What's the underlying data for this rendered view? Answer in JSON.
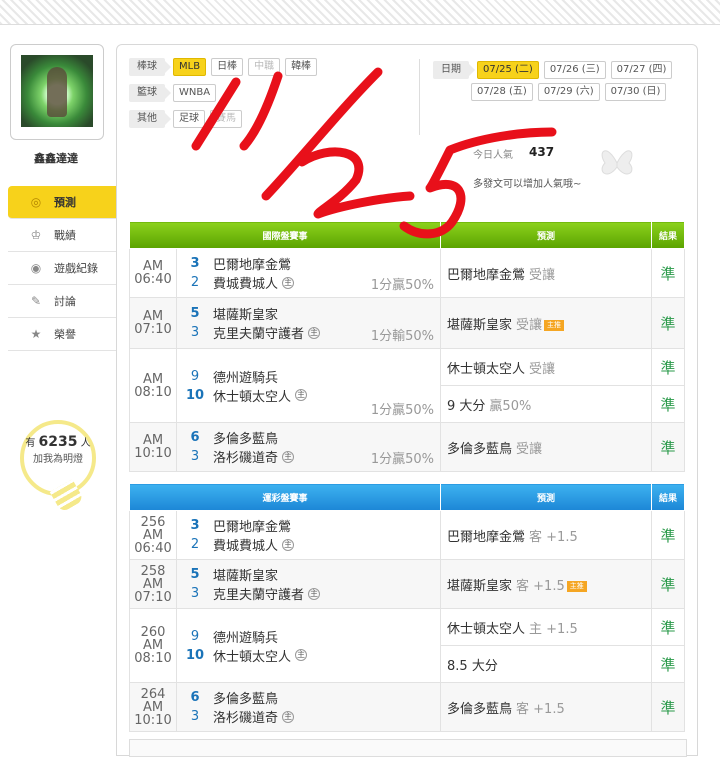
{
  "user": {
    "name": "鑫鑫達達"
  },
  "nav": [
    {
      "label": "預測",
      "icon": "target-icon",
      "active": true
    },
    {
      "label": "戰績",
      "icon": "trophy-icon",
      "active": false
    },
    {
      "label": "遊戲紀錄",
      "icon": "record-icon",
      "active": false
    },
    {
      "label": "討論",
      "icon": "discussion-icon",
      "active": false
    },
    {
      "label": "榮譽",
      "icon": "medal-icon",
      "active": false
    }
  ],
  "bulb": {
    "prefix": "有",
    "count": "6235",
    "unit": "人",
    "caption": "加我為明燈"
  },
  "filters": {
    "baseball_label": "棒球",
    "baseball": [
      "MLB",
      "日棒",
      "中職",
      "韓棒"
    ],
    "basketball_label": "籃球",
    "basketball": [
      "WNBA"
    ],
    "other_label": "其他",
    "other": [
      "足球",
      "賽馬"
    ]
  },
  "dates": {
    "label": "日期",
    "row1": [
      "07/25 (二)",
      "07/26 (三)",
      "07/27 (四)"
    ],
    "row2": [
      "07/28 (五)",
      "07/29 (六)",
      "07/30 (日)"
    ]
  },
  "popularity": {
    "label": "今日人氣",
    "value": "437",
    "tip": "多發文可以增加人氣哦~"
  },
  "intl": {
    "headers": [
      "國際盤賽事",
      "預測",
      "結果"
    ],
    "games": [
      {
        "time": "AM 06:40",
        "s1": "3",
        "t1": "巴爾地摩金鶯",
        "s2": "2",
        "t2": "費城費城人",
        "host": "主",
        "odds": "1分贏50%",
        "picks": [
          {
            "team": "巴爾地摩金鶯",
            "sub": "受讓",
            "badge": "",
            "result": "準"
          }
        ]
      },
      {
        "time": "AM 07:10",
        "s1": "5",
        "t1": "堪薩斯皇家",
        "s2": "3",
        "t2": "克里夫蘭守護者",
        "host": "主",
        "odds": "1分輸50%",
        "picks": [
          {
            "team": "堪薩斯皇家",
            "sub": "受讓",
            "badge": "主推",
            "result": "準"
          }
        ]
      },
      {
        "time": "AM 08:10",
        "s1": "9",
        "t1": "德州遊騎兵",
        "s2": "10",
        "t2": "休士頓太空人",
        "host": "主",
        "odds": "1分贏50%",
        "picks": [
          {
            "team": "休士頓太空人",
            "sub": "受讓",
            "badge": "",
            "result": "準"
          },
          {
            "team": "9 大分",
            "sub": "贏50%",
            "badge": "",
            "result": "準"
          }
        ]
      },
      {
        "time": "AM 10:10",
        "s1": "6",
        "t1": "多倫多藍鳥",
        "s2": "3",
        "t2": "洛杉磯道奇",
        "host": "主",
        "odds": "1分贏50%",
        "picks": [
          {
            "team": "多倫多藍鳥",
            "sub": "受讓",
            "badge": "",
            "result": "準"
          }
        ]
      }
    ]
  },
  "sports": {
    "headers": [
      "運彩盤賽事",
      "預測",
      "結果"
    ],
    "games": [
      {
        "no": "256",
        "time": "AM 06:40",
        "s1": "3",
        "t1": "巴爾地摩金鶯",
        "s2": "2",
        "t2": "費城費城人",
        "host": "主",
        "picks": [
          {
            "team": "巴爾地摩金鶯",
            "sub": "客 +1.5",
            "badge": "",
            "result": "準"
          }
        ]
      },
      {
        "no": "258",
        "time": "AM 07:10",
        "s1": "5",
        "t1": "堪薩斯皇家",
        "s2": "3",
        "t2": "克里夫蘭守護者",
        "host": "主",
        "picks": [
          {
            "team": "堪薩斯皇家",
            "sub": "客 +1.5",
            "badge": "主推",
            "result": "準"
          }
        ]
      },
      {
        "no": "260",
        "time": "AM 08:10",
        "s1": "9",
        "t1": "德州遊騎兵",
        "s2": "10",
        "t2": "休士頓太空人",
        "host": "主",
        "picks": [
          {
            "team": "休士頓太空人",
            "sub": "主 +1.5",
            "badge": "",
            "result": "準"
          },
          {
            "team": "8.5 大分",
            "sub": "",
            "badge": "",
            "result": "準"
          }
        ]
      },
      {
        "no": "264",
        "time": "AM 10:10",
        "s1": "6",
        "t1": "多倫多藍鳥",
        "s2": "3",
        "t2": "洛杉磯道奇",
        "host": "主",
        "picks": [
          {
            "team": "多倫多藍鳥",
            "sub": "客 +1.5",
            "badge": "",
            "result": "準"
          }
        ]
      }
    ]
  },
  "colors": {
    "accent": "#f7d21b",
    "win": "#2a9a4a",
    "scribble": "#e8101a"
  }
}
